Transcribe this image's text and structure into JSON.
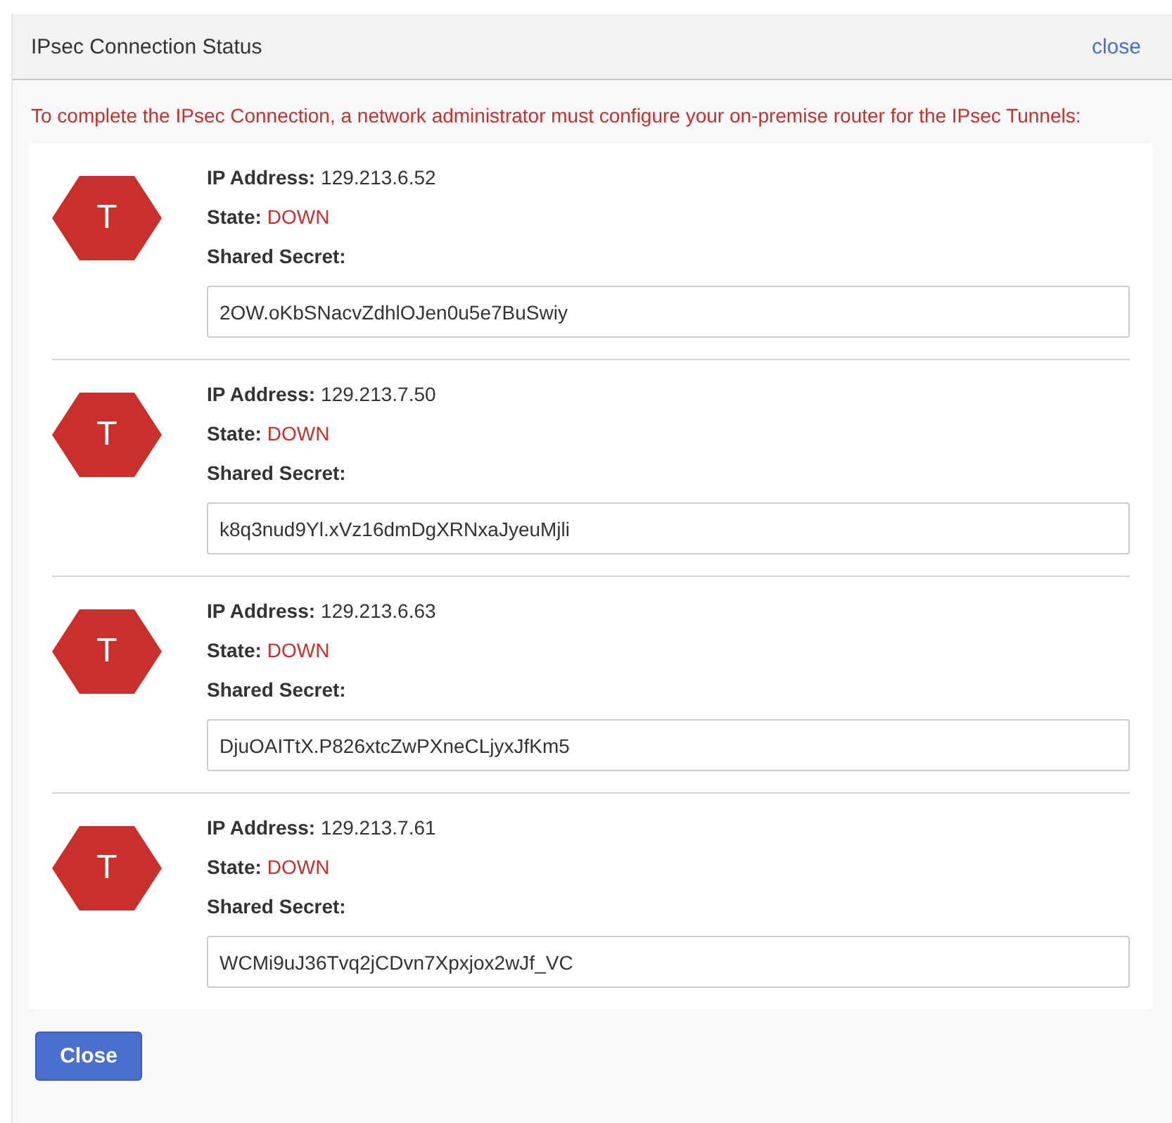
{
  "dialog": {
    "title": "IPsec Connection Status",
    "close_link": "close",
    "message": "To complete the IPsec Connection, a network administrator must configure your on-premise router for the IPsec Tunnels:",
    "tunnels": [
      {
        "badge": "T",
        "ip_label": "IP Address:",
        "ip": "129.213.6.52",
        "state_label": "State:",
        "state": "DOWN",
        "secret_label": "Shared Secret:",
        "secret": "2OW.oKbSNacvZdhlOJen0u5e7BuSwiy"
      },
      {
        "badge": "T",
        "ip_label": "IP Address:",
        "ip": "129.213.7.50",
        "state_label": "State:",
        "state": "DOWN",
        "secret_label": "Shared Secret:",
        "secret": "k8q3nud9Yl.xVz16dmDgXRNxaJyeuMjli"
      },
      {
        "badge": "T",
        "ip_label": "IP Address:",
        "ip": "129.213.6.63",
        "state_label": "State:",
        "state": "DOWN",
        "secret_label": "Shared Secret:",
        "secret": "DjuOAITtX.P826xtcZwPXneCLjyxJfKm5"
      },
      {
        "badge": "T",
        "ip_label": "IP Address:",
        "ip": "129.213.7.61",
        "state_label": "State:",
        "state": "DOWN",
        "secret_label": "Shared Secret:",
        "secret": "WCMi9uJ36Tvq2jCDvn7Xpxjox2wJf_VC"
      }
    ],
    "button": "Close"
  }
}
